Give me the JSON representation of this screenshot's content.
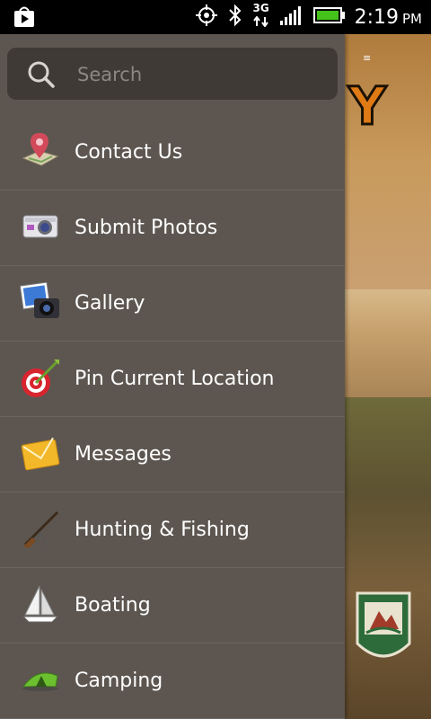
{
  "status_bar": {
    "network": "3G",
    "time": "2:19",
    "ampm": "PM"
  },
  "search": {
    "placeholder": "Search"
  },
  "menu": {
    "items": [
      {
        "label": "Contact Us",
        "icon": "map-pin-icon"
      },
      {
        "label": "Submit Photos",
        "icon": "camera-icon"
      },
      {
        "label": "Gallery",
        "icon": "photo-gallery-icon"
      },
      {
        "label": "Pin Current Location",
        "icon": "target-dart-icon"
      },
      {
        "label": "Messages",
        "icon": "envelope-icon"
      },
      {
        "label": "Hunting & Fishing",
        "icon": "rifle-icon"
      },
      {
        "label": "Boating",
        "icon": "sailboat-icon"
      },
      {
        "label": "Camping",
        "icon": "tent-icon"
      }
    ]
  },
  "colors": {
    "drawer_bg": "#5d5650",
    "search_bg": "#3f3a36",
    "divider": "#6c6560",
    "text": "#ffffff"
  }
}
